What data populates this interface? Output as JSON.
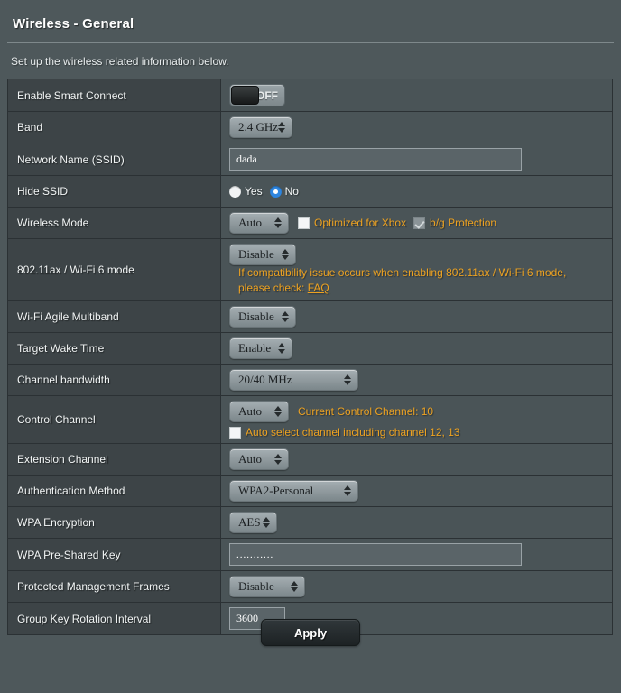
{
  "header": {
    "title": "Wireless - General",
    "subtitle": "Set up the wireless related information below."
  },
  "rows": {
    "smart_connect": {
      "label": "Enable Smart Connect",
      "toggle_state": "OFF"
    },
    "band": {
      "label": "Band",
      "value": "2.4 GHz"
    },
    "ssid": {
      "label": "Network Name (SSID)",
      "value": "dada"
    },
    "hide_ssid": {
      "label": "Hide SSID",
      "yes_label": "Yes",
      "no_label": "No",
      "selected": "No"
    },
    "wireless_mode": {
      "label": "Wireless Mode",
      "value": "Auto",
      "xbox_label": "Optimized for Xbox",
      "xbox_checked": false,
      "bg_label": "b/g Protection",
      "bg_checked": true,
      "bg_disabled": true
    },
    "ax_mode": {
      "label": "802.11ax / Wi-Fi 6 mode",
      "value": "Disable",
      "note_line1": "If compatibility issue occurs when enabling 802.11ax / Wi-Fi 6 mode,",
      "note_line2_prefix": "please check:",
      "note_link": "FAQ"
    },
    "agile_multiband": {
      "label": "Wi-Fi Agile Multiband",
      "value": "Disable"
    },
    "target_wake_time": {
      "label": "Target Wake Time",
      "value": "Enable"
    },
    "channel_bandwidth": {
      "label": "Channel bandwidth",
      "value": "20/40 MHz"
    },
    "control_channel": {
      "label": "Control Channel",
      "value": "Auto",
      "current_channel_text": "Current Control Channel: 10",
      "auto_select_label": "Auto select channel including channel 12, 13",
      "auto_select_checked": false
    },
    "extension_channel": {
      "label": "Extension Channel",
      "value": "Auto"
    },
    "auth_method": {
      "label": "Authentication Method",
      "value": "WPA2-Personal"
    },
    "wpa_encryption": {
      "label": "WPA Encryption",
      "value": "AES"
    },
    "wpa_psk": {
      "label": "WPA Pre-Shared Key",
      "value": "...........",
      "masked": true
    },
    "pmf": {
      "label": "Protected Management Frames",
      "value": "Disable"
    },
    "group_key": {
      "label": "Group Key Rotation Interval",
      "value": "3600"
    }
  },
  "footer": {
    "apply_label": "Apply"
  },
  "colors": {
    "page_background": "#4e585b",
    "label_column": "#3d4447",
    "value_column": "#4a5457",
    "border": "#2b3134",
    "accent_orange": "#eda221",
    "radio_selected_blue": "#2e86e0",
    "text_primary": "#f2f5f5"
  }
}
